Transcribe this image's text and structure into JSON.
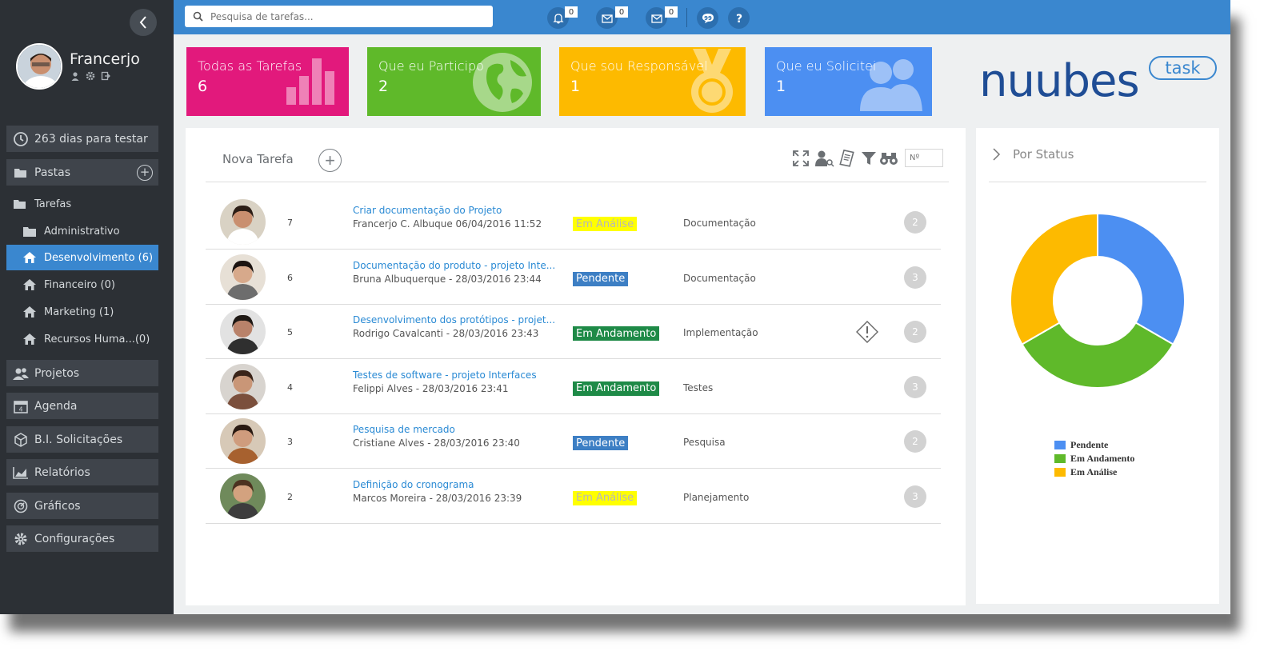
{
  "sidebar": {
    "user_name": "Francerjo",
    "trial": "263 dias para testar",
    "pastas": "Pastas",
    "tarefas": "Tarefas",
    "folders": [
      {
        "label": "Administrativo",
        "icon": "folder-icon"
      },
      {
        "label": "Desenvolvimento (6)",
        "icon": "home-icon",
        "active": true
      },
      {
        "label": "Financeiro (0)",
        "icon": "home-icon"
      },
      {
        "label": "Marketing (1)",
        "icon": "home-icon"
      },
      {
        "label": "Recursos Huma...(0)",
        "icon": "home-icon"
      }
    ],
    "menu": [
      {
        "label": "Projetos",
        "icon": "users-icon"
      },
      {
        "label": "Agenda",
        "icon": "calendar-icon"
      },
      {
        "label": "B.I. Solicitações",
        "icon": "cube-icon"
      },
      {
        "label": "Relatórios",
        "icon": "chart-icon"
      },
      {
        "label": "Gráficos",
        "icon": "gauge-icon"
      },
      {
        "label": "Configurações",
        "icon": "gear-icon"
      }
    ]
  },
  "topbar": {
    "search_placeholder": "Pesquisa de tarefas...",
    "badges": [
      "0",
      "0",
      "0"
    ]
  },
  "tiles": [
    {
      "label": "Todas as Tarefas",
      "count": "6",
      "color": "#e2197c"
    },
    {
      "label": "Que eu Participo",
      "count": "2",
      "color": "#5fb92a"
    },
    {
      "label": "Que sou Responsável",
      "count": "1",
      "color": "#fdba00"
    },
    {
      "label": "Que eu Solicitei",
      "count": "1",
      "color": "#4c8ff2"
    }
  ],
  "logo": {
    "word": "nuubes",
    "pill": "task"
  },
  "tasks": {
    "new_label": "Nova Tarefa",
    "number_placeholder": "Nº",
    "rows": [
      {
        "num": "7",
        "title": "Criar documentação do Projeto",
        "sub": "Francerjo C. Albuque 06/04/2016 11:52",
        "status": "Em Análise",
        "category": "Documentação",
        "count": "2",
        "warn": false
      },
      {
        "num": "6",
        "title": "Documentação do produto - projeto Inte...",
        "sub": "Bruna Albuquerque - 28/03/2016 23:44",
        "status": "Pendente",
        "category": "Documentação",
        "count": "3",
        "warn": false
      },
      {
        "num": "5",
        "title": "Desenvolvimento dos protótipos - projet...",
        "sub": "Rodrigo Cavalcanti - 28/03/2016 23:43",
        "status": "Em Andamento",
        "category": "Implementação",
        "count": "2",
        "warn": true
      },
      {
        "num": "4",
        "title": "Testes de software - projeto Interfaces",
        "sub": "Felippi Alves - 28/03/2016 23:41",
        "status": "Em Andamento",
        "category": "Testes",
        "count": "3",
        "warn": false
      },
      {
        "num": "3",
        "title": "Pesquisa de mercado",
        "sub": "Cristiane Alves - 28/03/2016 23:40",
        "status": "Pendente",
        "category": "Pesquisa",
        "count": "2",
        "warn": false
      },
      {
        "num": "2",
        "title": "Definição do cronograma",
        "sub": "Marcos Moreira - 28/03/2016 23:39",
        "status": "Em Análise",
        "category": "Planejamento",
        "count": "3",
        "warn": false
      }
    ]
  },
  "status_colors": {
    "Em Análise": {
      "bg": "#ffff00",
      "fg": "#b8b8b8"
    },
    "Pendente": {
      "bg": "#3d7fc4",
      "fg": "#ffffff"
    },
    "Em Andamento": {
      "bg": "#1e8a47",
      "fg": "#ffffff"
    }
  },
  "status_panel": {
    "title": "Por Status"
  },
  "chart_data": {
    "type": "pie",
    "donut": true,
    "series": [
      {
        "name": "Pendente",
        "value": 2,
        "color": "#4c8ff2"
      },
      {
        "name": "Em Andamento",
        "value": 2,
        "color": "#5fb92a"
      },
      {
        "name": "Em Análise",
        "value": 2,
        "color": "#fdba00"
      }
    ],
    "legend_position": "bottom"
  }
}
